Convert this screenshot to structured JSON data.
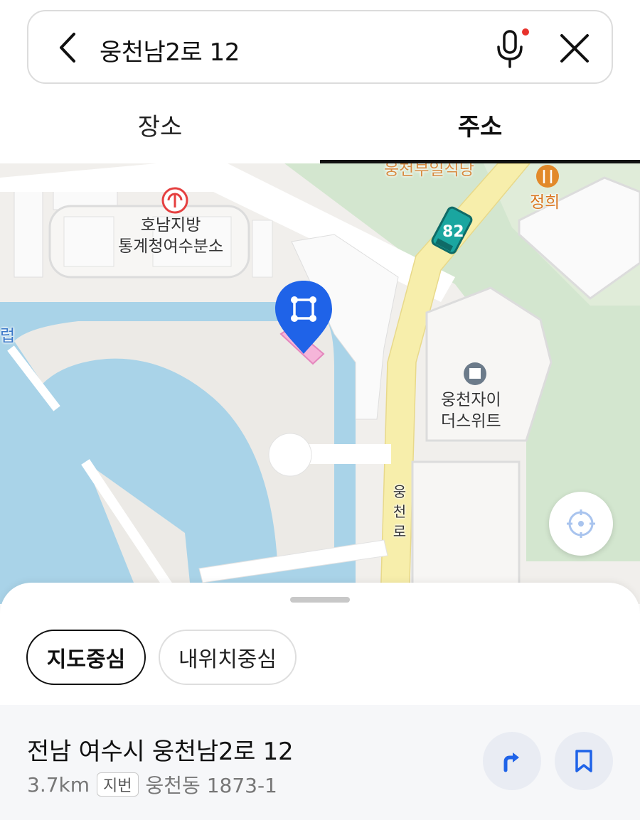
{
  "search": {
    "query": "웅천남2로 12"
  },
  "tabs": [
    {
      "label": "장소",
      "active": false
    },
    {
      "label": "주소",
      "active": true
    }
  ],
  "map": {
    "labels": {
      "office": "호남지방\n통계청여수분소",
      "restaurant": "정희",
      "restaurant_top": "웅천부일식당",
      "apartment": "웅천자이\n더스위트",
      "road": "웅천로",
      "edge": "럽",
      "bus_route": "82"
    }
  },
  "sheet": {
    "chips": [
      {
        "label": "지도중심",
        "selected": true
      },
      {
        "label": "내위치중심",
        "selected": false
      }
    ],
    "result": {
      "address": "전남 여수시 웅천남2로 12",
      "distance": "3.7km",
      "badge": "지번",
      "lot_address": "웅천동 1873-1"
    }
  },
  "colors": {
    "accent_blue": "#1f63e8",
    "water": "#a9d3e8",
    "park": "#d3e6cf",
    "road_main": "#f7eeab",
    "pin_highlight": "#f5b5d9"
  }
}
